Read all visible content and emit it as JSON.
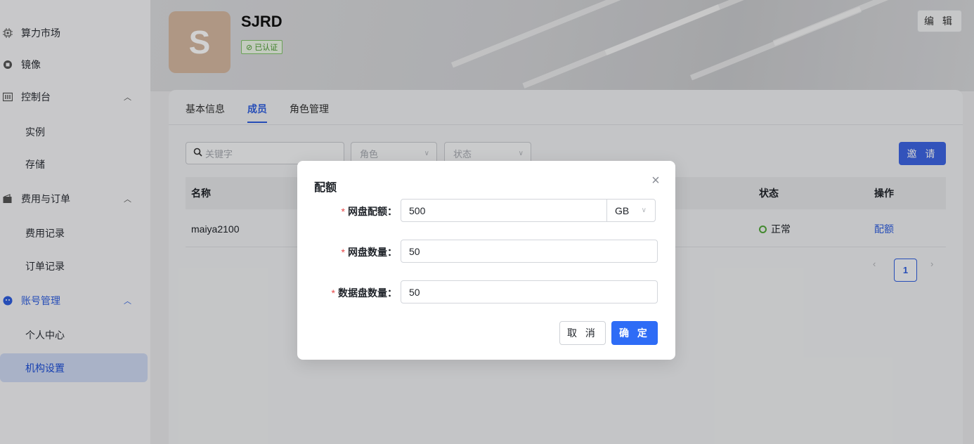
{
  "sidebar": {
    "items": [
      {
        "label": "算力市场",
        "icon": "chip-icon"
      },
      {
        "label": "镜像",
        "icon": "image-icon"
      },
      {
        "label": "控制台",
        "icon": "console-icon"
      },
      {
        "label": "实例"
      },
      {
        "label": "存储"
      },
      {
        "label": "费用与订单",
        "icon": "wallet-icon"
      },
      {
        "label": "费用记录"
      },
      {
        "label": "订单记录"
      },
      {
        "label": "账号管理",
        "icon": "account-icon"
      },
      {
        "label": "个人中心"
      },
      {
        "label": "机构设置"
      }
    ]
  },
  "header": {
    "avatar_letter": "S",
    "org_name": "SJRD",
    "verified_label": "已认证",
    "edit_label": "编 辑"
  },
  "tabs": [
    "基本信息",
    "成员",
    "角色管理"
  ],
  "toolbar": {
    "search_placeholder": "关键字",
    "role_filter": "角色",
    "status_filter": "状态",
    "invite_label": "邀 请"
  },
  "table": {
    "columns": [
      "名称",
      "状态",
      "操作"
    ],
    "rows": [
      {
        "name": "maiya2100",
        "status": "正常",
        "action": "配额"
      }
    ]
  },
  "pagination": {
    "current": "1"
  },
  "modal": {
    "title": "配额",
    "fields": [
      {
        "label": "网盘配额",
        "value": "500",
        "unit": "GB"
      },
      {
        "label": "网盘数量",
        "value": "50"
      },
      {
        "label": "数据盘数量",
        "value": "50"
      }
    ],
    "cancel_label": "取 消",
    "ok_label": "确 定"
  },
  "colors": {
    "primary": "#2e6cf6",
    "success": "#52a83a",
    "required": "#e54848"
  }
}
